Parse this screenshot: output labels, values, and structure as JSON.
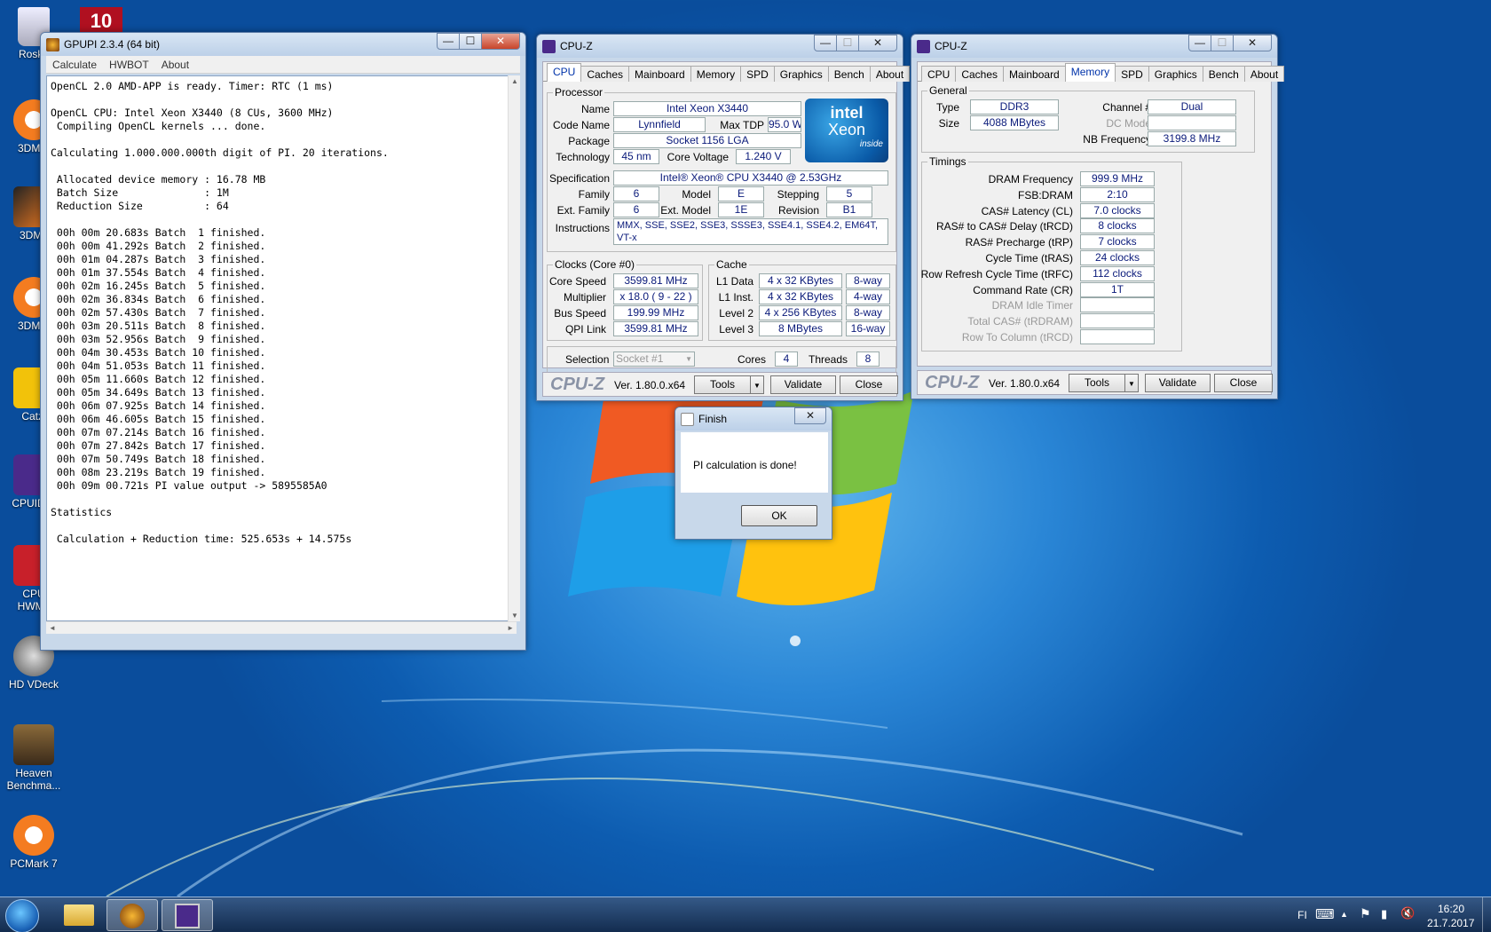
{
  "desktop": {
    "icons": [
      {
        "label": "Roska"
      },
      {
        "label": "3DMar"
      },
      {
        "label": "3DMa"
      },
      {
        "label": "3DMar"
      },
      {
        "label": "Catzi"
      },
      {
        "label": "CPUID C"
      },
      {
        "label": "CPU"
      },
      {
        "label": "HWMo"
      },
      {
        "label": "HD VDeck"
      },
      {
        "label": "Heaven"
      },
      {
        "label": "Benchma..."
      },
      {
        "label": "PCMark 7"
      }
    ],
    "badge": "10"
  },
  "gpupi": {
    "title": "GPUPI 2.3.4 (64 bit)",
    "menu": [
      "Calculate",
      "HWBOT",
      "About"
    ],
    "lines": [
      "OpenCL 2.0 AMD-APP is ready. Timer: RTC (1 ms)",
      "",
      "OpenCL CPU: Intel Xeon X3440 (8 CUs, 3600 MHz)",
      " Compiling OpenCL kernels ... done.",
      "",
      "Calculating 1.000.000.000th digit of PI. 20 iterations.",
      "",
      " Allocated device memory : 16.78 MB",
      " Batch Size              : 1M",
      " Reduction Size          : 64",
      "",
      " 00h 00m 20.683s Batch  1 finished.",
      " 00h 00m 41.292s Batch  2 finished.",
      " 00h 01m 04.287s Batch  3 finished.",
      " 00h 01m 37.554s Batch  4 finished.",
      " 00h 02m 16.245s Batch  5 finished.",
      " 00h 02m 36.834s Batch  6 finished.",
      " 00h 02m 57.430s Batch  7 finished.",
      " 00h 03m 20.511s Batch  8 finished.",
      " 00h 03m 52.956s Batch  9 finished.",
      " 00h 04m 30.453s Batch 10 finished.",
      " 00h 04m 51.053s Batch 11 finished.",
      " 00h 05m 11.660s Batch 12 finished.",
      " 00h 05m 34.649s Batch 13 finished.",
      " 00h 06m 07.925s Batch 14 finished.",
      " 00h 06m 46.605s Batch 15 finished.",
      " 00h 07m 07.214s Batch 16 finished.",
      " 00h 07m 27.842s Batch 17 finished.",
      " 00h 07m 50.749s Batch 18 finished.",
      " 00h 08m 23.219s Batch 19 finished.",
      " 00h 09m 00.721s PI value output -> 5895585A0",
      "",
      "Statistics",
      "",
      " Calculation + Reduction time: 525.653s + 14.575s"
    ]
  },
  "cpuz_cpu": {
    "title": "CPU-Z",
    "tabs": [
      "CPU",
      "Caches",
      "Mainboard",
      "Memory",
      "SPD",
      "Graphics",
      "Bench",
      "About"
    ],
    "active_tab": "CPU",
    "processor_group": "Processor",
    "name_label": "Name",
    "name": "Intel Xeon X3440",
    "codename_label": "Code Name",
    "codename": "Lynnfield",
    "maxtdp_label": "Max TDP",
    "maxtdp": "95.0 W",
    "package_label": "Package",
    "package": "Socket 1156 LGA",
    "technology_label": "Technology",
    "technology": "45 nm",
    "corevoltage_label": "Core Voltage",
    "corevoltage": "1.240 V",
    "spec_label": "Specification",
    "spec": "Intel® Xeon® CPU         X3440  @ 2.53GHz",
    "family_label": "Family",
    "family": "6",
    "model_label": "Model",
    "model": "E",
    "stepping_label": "Stepping",
    "stepping": "5",
    "extfamily_label": "Ext. Family",
    "extfamily": "6",
    "extmodel_label": "Ext. Model",
    "extmodel": "1E",
    "revision_label": "Revision",
    "revision": "B1",
    "instructions_label": "Instructions",
    "instructions": "MMX, SSE, SSE2, SSE3, SSSE3, SSE4.1, SSE4.2, EM64T, VT-x",
    "logo_top": "intel",
    "logo_mid": "Xeon",
    "logo_bot": "inside",
    "clocks_group": "Clocks (Core #0)",
    "corespeed_label": "Core Speed",
    "corespeed": "3599.81 MHz",
    "multiplier_label": "Multiplier",
    "multiplier": "x 18.0 ( 9 - 22 )",
    "busspeed_label": "Bus Speed",
    "busspeed": "199.99 MHz",
    "qpilink_label": "QPI Link",
    "qpilink": "3599.81 MHz",
    "cache_group": "Cache",
    "l1d_label": "L1 Data",
    "l1d": "4 x 32 KBytes",
    "l1d_way": "8-way",
    "l1i_label": "L1 Inst.",
    "l1i": "4 x 32 KBytes",
    "l1i_way": "4-way",
    "l2_label": "Level 2",
    "l2": "4 x 256 KBytes",
    "l2_way": "8-way",
    "l3_label": "Level 3",
    "l3": "8 MBytes",
    "l3_way": "16-way",
    "selection_label": "Selection",
    "selection": "Socket #1",
    "cores_label": "Cores",
    "cores": "4",
    "threads_label": "Threads",
    "threads": "8",
    "brand": "CPU-Z",
    "version": "Ver. 1.80.0.x64",
    "tools": "Tools",
    "validate": "Validate",
    "close": "Close"
  },
  "cpuz_mem": {
    "title": "CPU-Z",
    "tabs": [
      "CPU",
      "Caches",
      "Mainboard",
      "Memory",
      "SPD",
      "Graphics",
      "Bench",
      "About"
    ],
    "active_tab": "Memory",
    "general_group": "General",
    "type_label": "Type",
    "type": "DDR3",
    "channel_label": "Channel #",
    "channel": "Dual",
    "size_label": "Size",
    "size": "4088 MBytes",
    "dcmode_label": "DC Mode",
    "dcmode": "",
    "nbfreq_label": "NB Frequency",
    "nbfreq": "3199.8 MHz",
    "timings_group": "Timings",
    "timings": [
      {
        "label": "DRAM Frequency",
        "value": "999.9 MHz",
        "dim": false
      },
      {
        "label": "FSB:DRAM",
        "value": "2:10",
        "dim": false
      },
      {
        "label": "CAS# Latency (CL)",
        "value": "7.0 clocks",
        "dim": false
      },
      {
        "label": "RAS# to CAS# Delay (tRCD)",
        "value": "8 clocks",
        "dim": false
      },
      {
        "label": "RAS# Precharge (tRP)",
        "value": "7 clocks",
        "dim": false
      },
      {
        "label": "Cycle Time (tRAS)",
        "value": "24 clocks",
        "dim": false
      },
      {
        "label": "Row Refresh Cycle Time (tRFC)",
        "value": "112 clocks",
        "dim": false
      },
      {
        "label": "Command Rate (CR)",
        "value": "1T",
        "dim": false
      },
      {
        "label": "DRAM Idle Timer",
        "value": "",
        "dim": true
      },
      {
        "label": "Total CAS# (tRDRAM)",
        "value": "",
        "dim": true
      },
      {
        "label": "Row To Column (tRCD)",
        "value": "",
        "dim": true
      }
    ],
    "brand": "CPU-Z",
    "version": "Ver. 1.80.0.x64",
    "tools": "Tools",
    "validate": "Validate",
    "close": "Close"
  },
  "finish": {
    "title": "Finish",
    "message": "PI calculation is done!",
    "ok": "OK"
  },
  "taskbar": {
    "lang": "FI",
    "time": "16:20",
    "date": "21.7.2017"
  },
  "icons": {
    "minimize": "—",
    "maximize": "☐",
    "close": "✕",
    "dropdown": "▼",
    "up": "▲",
    "down": "▼",
    "left": "◄",
    "right": "►",
    "tray_up": "▲",
    "keyboard": "⌨",
    "flag": "⚑",
    "signal": "▮",
    "speaker": "🔇"
  },
  "colors": {
    "accent": "#0033aa",
    "value_text": "#0a1a7a"
  }
}
